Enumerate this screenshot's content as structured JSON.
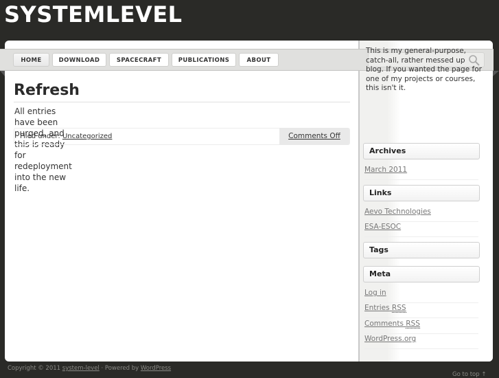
{
  "header": {
    "site_title": "SYSTEMLEVEL"
  },
  "nav": {
    "items": [
      {
        "label": "HOME",
        "active": true
      },
      {
        "label": "DOWNLOAD"
      },
      {
        "label": "SPACECRAFT"
      },
      {
        "label": "PUBLICATIONS"
      },
      {
        "label": "ABOUT"
      }
    ],
    "search": {
      "placeholder": "",
      "value": "",
      "icon": "search-icon"
    }
  },
  "post": {
    "title": "Refresh",
    "body": "All entries have been purged, and this is ready for redeployment into the new life.",
    "filed_under_label": "Filed under:",
    "category": "Uncategorized",
    "comments": "Comments Off"
  },
  "sidebar": {
    "intro": "This is my general-purpose, catch-all, rather messed up blog. If you wanted the page for one of my projects or courses, this isn't it.",
    "archives": {
      "title": "Archives",
      "items": [
        "March 2011"
      ]
    },
    "links": {
      "title": "Links",
      "items": [
        "Aevo Technologies",
        "ESA-ESOC"
      ]
    },
    "tags": {
      "title": "Tags"
    },
    "meta": {
      "title": "Meta",
      "log_in": "Log in",
      "entries": "Entries",
      "comments": "Comments",
      "rss": "RSS",
      "wordpress": "WordPress.org"
    }
  },
  "footer": {
    "copyright": "Copyright © 2011",
    "site_link": "system-level",
    "powered_by": "· Powered by",
    "wp_link": "WordPress",
    "go_top": "Go to top ↑"
  }
}
